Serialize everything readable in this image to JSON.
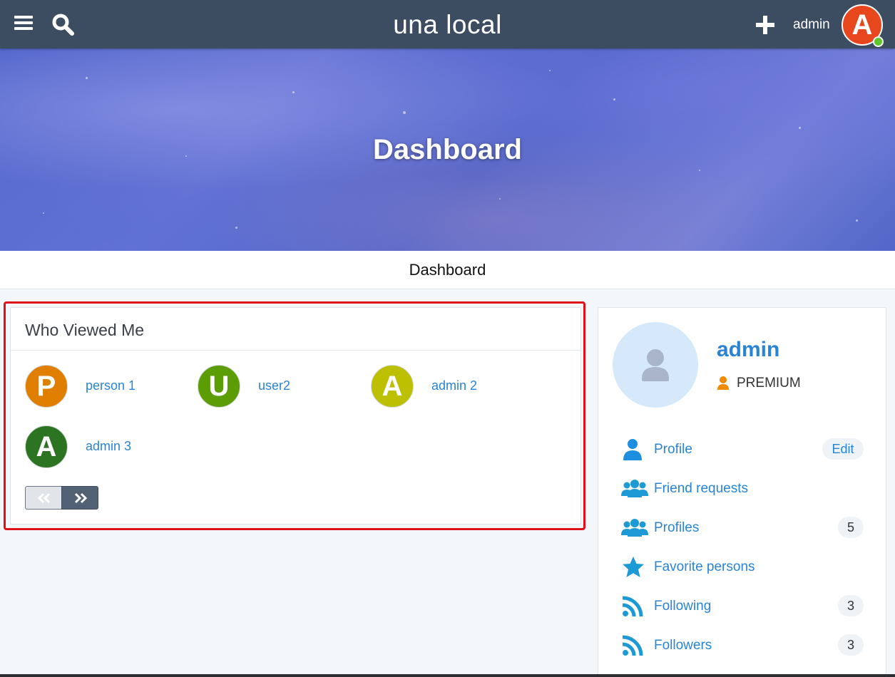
{
  "topbar": {
    "site_title": "una local",
    "user_name": "admin",
    "avatar_letter": "A",
    "menu_icon": "hamburger-icon",
    "search_icon": "search-icon",
    "plus_icon": "plus-icon"
  },
  "cover": {
    "title": "Dashboard"
  },
  "page": {
    "title": "Dashboard"
  },
  "who_viewed": {
    "title": "Who Viewed Me",
    "viewers": [
      {
        "letter": "P",
        "name": "person 1",
        "color": "#e07e00"
      },
      {
        "letter": "U",
        "name": "user2",
        "color": "#5c9c05"
      },
      {
        "letter": "A",
        "name": "admin 2",
        "color": "#bcc000"
      },
      {
        "letter": "A",
        "name": "admin 3",
        "color": "#2d7422"
      }
    ],
    "pager": {
      "prev_icon": "double-chevron-left-icon",
      "next_icon": "double-chevron-right-icon"
    }
  },
  "sidebar": {
    "name": "admin",
    "badge": "PREMIUM",
    "badge_color": "#f08a00",
    "items": [
      {
        "label": "Profile",
        "icon": "user-icon",
        "action": "Edit"
      },
      {
        "label": "Friend requests",
        "icon": "users-icon"
      },
      {
        "label": "Profiles",
        "icon": "users-icon",
        "count": "5"
      },
      {
        "label": "Favorite persons",
        "icon": "star-icon"
      },
      {
        "label": "Following",
        "icon": "rss-icon",
        "count": "3"
      },
      {
        "label": "Followers",
        "icon": "rss-icon",
        "count": "3"
      }
    ]
  },
  "colors": {
    "topbar": "#3c4c61",
    "link": "#2a84d6",
    "icon_blue": "#1d9ad6",
    "highlight": "#e0101a"
  }
}
